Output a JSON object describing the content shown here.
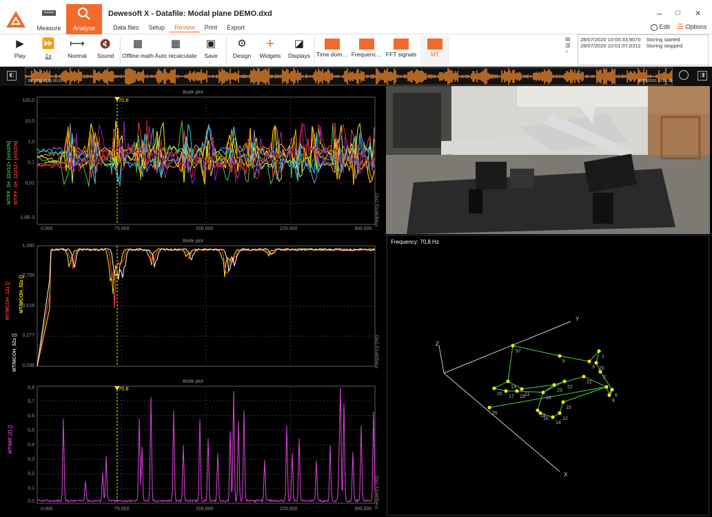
{
  "app": {
    "title": "Dewesoft X - Datafile: Modal plane DEMO.dxd",
    "nav_measure": "Measure",
    "nav_analyse": "Analyse",
    "tabs": [
      "Data files",
      "Setup",
      "Review",
      "Print",
      "Export"
    ],
    "active_tab": "Review",
    "edit_label": "Edit",
    "options_label": "Options",
    "minimize": "–",
    "maximize": "□",
    "close": "✕"
  },
  "toolbar": {
    "play": "Play",
    "speed": "1x",
    "normal": "Normal",
    "sound": "Sound",
    "offline_math": "Offline math",
    "auto_recalculate": "Auto recalculate",
    "save": "Save",
    "design": "Design",
    "widgets": "Widgets",
    "displays": "Displays",
    "time_dom": "Time dom…",
    "frequenc": "Frequenc…",
    "fft_signals": "FFT signals",
    "mt": "MT"
  },
  "log": [
    {
      "time": "28/07/2020 10:00:33,9070",
      "msg": "Storing started"
    },
    {
      "time": "28/07/2020 10:01:07,6312",
      "msg": "Storing stopped"
    }
  ],
  "overview": {
    "start": "28/07/2020 10:00:33",
    "end": "28/07/2020 10:01:10"
  },
  "plots": {
    "bode1": {
      "title": "Bode plot",
      "cursor": "70,8",
      "yticks": [
        "100,0",
        "10,0",
        "1,0",
        "0,1",
        "0,01",
        "1,0E-3"
      ],
      "xticks": [
        "0,000",
        "75,000",
        "150,000",
        "225,000",
        "300,000"
      ],
      "ylabel_a": "MT/FF_1H_22z/1Z+ [m/s2/N]",
      "ylabel_b": "MT/FF_1H_12z/1Z+ [m/s2/N]",
      "freq": "Frequency (Hz)"
    },
    "bode2": {
      "title": "Bode plot",
      "yticks": [
        "1,000",
        "0,759",
        "0,518",
        "0,277",
        "0,036"
      ],
      "xticks": [],
      "ylabel_a": "MT/MCOH_1Zz []",
      "ylabel_b": "MT/MCOH_5Zz []",
      "ylabel_c": "MT/MCOH_52z []",
      "freq": "Frequency (Hz)"
    },
    "bode3": {
      "title": "Bode plot",
      "cursor": "70,8",
      "yticks": [
        "0,8",
        "0,7",
        "0,6",
        "0,5",
        "0,4",
        "0,3",
        "0,2",
        "0,1",
        "0,0"
      ],
      "xticks": [
        "0,000",
        "75,000",
        "150,000",
        "225,000",
        "300,000"
      ],
      "ylabel": "MT/MIF (Z) []",
      "freq": "Frequency (Hz)"
    }
  },
  "model": {
    "frequency": "Frequency: 70,8 Hz",
    "axes": [
      "X",
      "Y",
      "Z"
    ],
    "nodes": [
      "97",
      "5",
      "3",
      "1",
      "20",
      "2",
      "21",
      "13",
      "11",
      "23",
      "22",
      "15",
      "17",
      "19",
      "24",
      "4",
      "6",
      "8",
      "10",
      "18",
      "12",
      "16",
      "14",
      "25"
    ]
  },
  "colors": {
    "accent": "#f26b2a",
    "cursor": "#ffee00",
    "mif": "#d23fd2"
  }
}
